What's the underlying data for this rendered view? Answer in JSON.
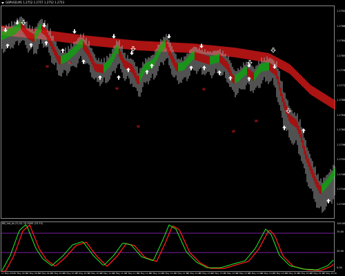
{
  "window": {
    "title": "GBPUSD,M1 1.2752 1.2757 1.2752 1.2753",
    "indicator_label": "BB_Ind_Av (9,14) 70.0000 (23.33)"
  },
  "price_scale": {
    "ticks": [
      "1.2792",
      "1.2788",
      "1.2784",
      "1.2780",
      "1.2776",
      "1.2772",
      "1.2768",
      "1.2764",
      "1.2760",
      "1.2756",
      "1.2752",
      "1.2748",
      "1.2744",
      "1.2740"
    ]
  },
  "osc_scale": {
    "ticks": [
      "100.00",
      "70.00",
      "30.00",
      "0.00"
    ]
  },
  "time_axis": {
    "labels": [
      "17 May 2019",
      "17 May 09:15",
      "17 May 09:30",
      "17 May 09:45",
      "17 May 10:00",
      "17 May 10:15",
      "17 May 10:30",
      "17 May 10:45",
      "17 May 11:00",
      "17 May 11:15",
      "17 May 11:30",
      "17 May 11:45",
      "17 May 12:00",
      "17 May 12:15",
      "17 May 12:30",
      "17 May 12:45",
      "17 May 13:00",
      "17 May 13:15",
      "17 May 13:30",
      "17 May 13:45",
      "17 May 14:00",
      "17 May 14:15",
      "17 May 14:30",
      "17 May 14:45",
      "17 May 15:00",
      "17 May 15:15",
      "17 May 15:30"
    ]
  },
  "colors": {
    "background": "#000000",
    "frame": "#8a8a8a",
    "band_red": "#d81818",
    "band_green": "#22c422",
    "candle_white": "#cccccc",
    "arrow_white": "#ffffff",
    "signal_red": "#ff2020",
    "osc_level": "#7a1fa0",
    "osc_fast": "#22e022",
    "osc_slow": "#ff1a1a"
  },
  "arrows": {
    "up_icon": "arrow-up-icon",
    "down_icon": "arrow-down-icon",
    "hollow_down_icon": "hollow-arrow-down-icon",
    "signal_mark": "w"
  }
}
